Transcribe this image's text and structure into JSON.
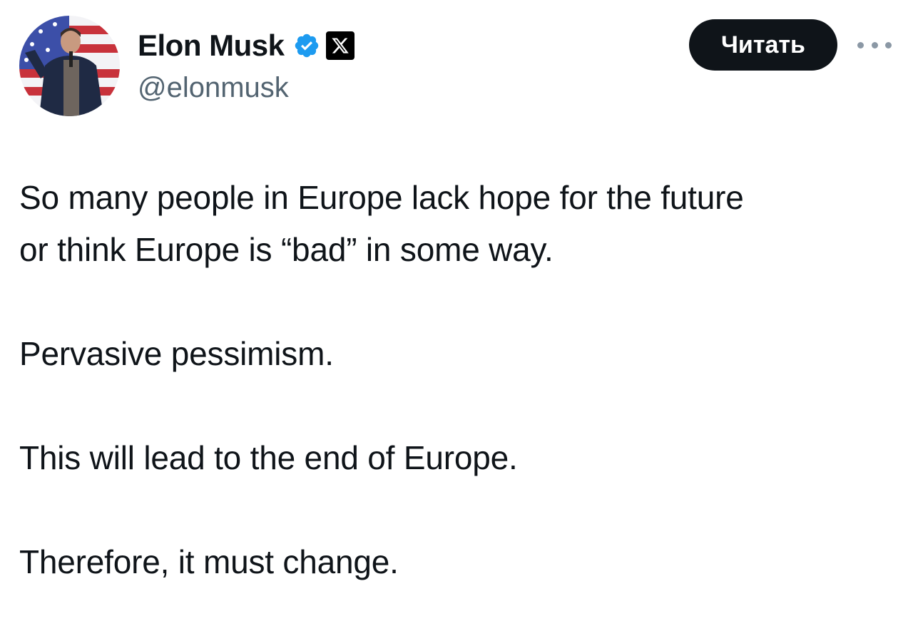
{
  "author": {
    "name": "Elon Musk",
    "handle": "@elonmusk",
    "verified_icon": "verified-badge-icon",
    "affiliation_icon": "x-logo-icon",
    "verified_color": "#1d9bf0"
  },
  "actions": {
    "follow_label": "Читать",
    "more_icon": "more-dots-icon"
  },
  "tweet": {
    "paragraphs": [
      "So many people in Europe lack hope for the future",
      "or think Europe is “bad” in some way.",
      "Pervasive pessimism.",
      "This will lead to the end of Europe.",
      "Therefore, it must change."
    ]
  },
  "colors": {
    "text_primary": "#0f1419",
    "text_secondary": "#536471",
    "button_bg": "#0f1419",
    "button_text": "#ffffff",
    "more_dots": "#8b98a5"
  }
}
